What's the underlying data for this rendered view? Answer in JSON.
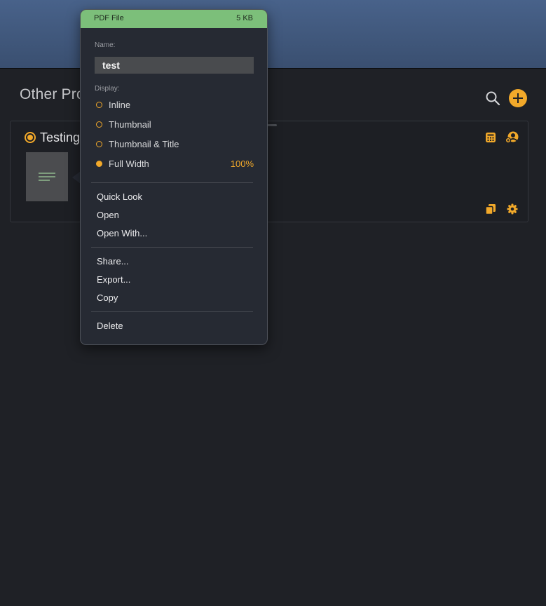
{
  "section": {
    "title": "Other Pro"
  },
  "card": {
    "title": "Testing"
  },
  "popover": {
    "file_type": "PDF File",
    "file_size": "5 KB",
    "name_label": "Name:",
    "name_value": "test",
    "display_label": "Display:",
    "display_options": [
      {
        "label": "Inline",
        "selected": false
      },
      {
        "label": "Thumbnail",
        "selected": false
      },
      {
        "label": "Thumbnail & Title",
        "selected": false
      },
      {
        "label": "Full Width",
        "selected": true,
        "percent": "100%"
      }
    ],
    "menu_group_1": [
      "Quick Look",
      "Open",
      "Open With..."
    ],
    "menu_group_2": [
      "Share...",
      "Export...",
      "Copy"
    ],
    "menu_group_3": [
      "Delete"
    ]
  },
  "icons": {
    "top_search": "search-icon",
    "top_add": "plus-circle-icon",
    "card_calculator": "calculator-icon",
    "card_assign": "person-add-icon",
    "card_copy": "copy-icon",
    "card_settings": "gear-icon"
  },
  "colors": {
    "accent": "#f2a92a",
    "header_green": "#7cbf7a",
    "titlebar": "#48628a",
    "background": "#1f2126"
  }
}
